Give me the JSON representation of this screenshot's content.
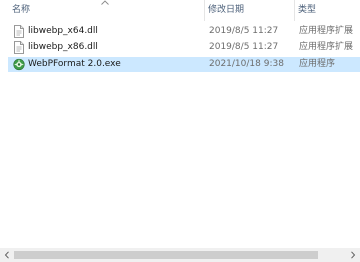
{
  "columns": {
    "name": "名称",
    "date": "修改日期",
    "type": "类型"
  },
  "files": [
    {
      "name": "libwebp_x64.dll",
      "date": "2019/8/5 11:27",
      "type": "应用程序扩展",
      "icon": "dll-file-icon",
      "selected": false
    },
    {
      "name": "libwebp_x86.dll",
      "date": "2019/8/5 11:27",
      "type": "应用程序扩展",
      "icon": "dll-file-icon",
      "selected": false
    },
    {
      "name": "WebPFormat 2.0.exe",
      "date": "2021/10/18 9:38",
      "type": "应用程序",
      "icon": "webp-app-icon",
      "selected": true
    }
  ],
  "colors": {
    "selection": "#cce8ff",
    "header_text": "#4c607a",
    "secondary_text": "#6d6d6d"
  }
}
